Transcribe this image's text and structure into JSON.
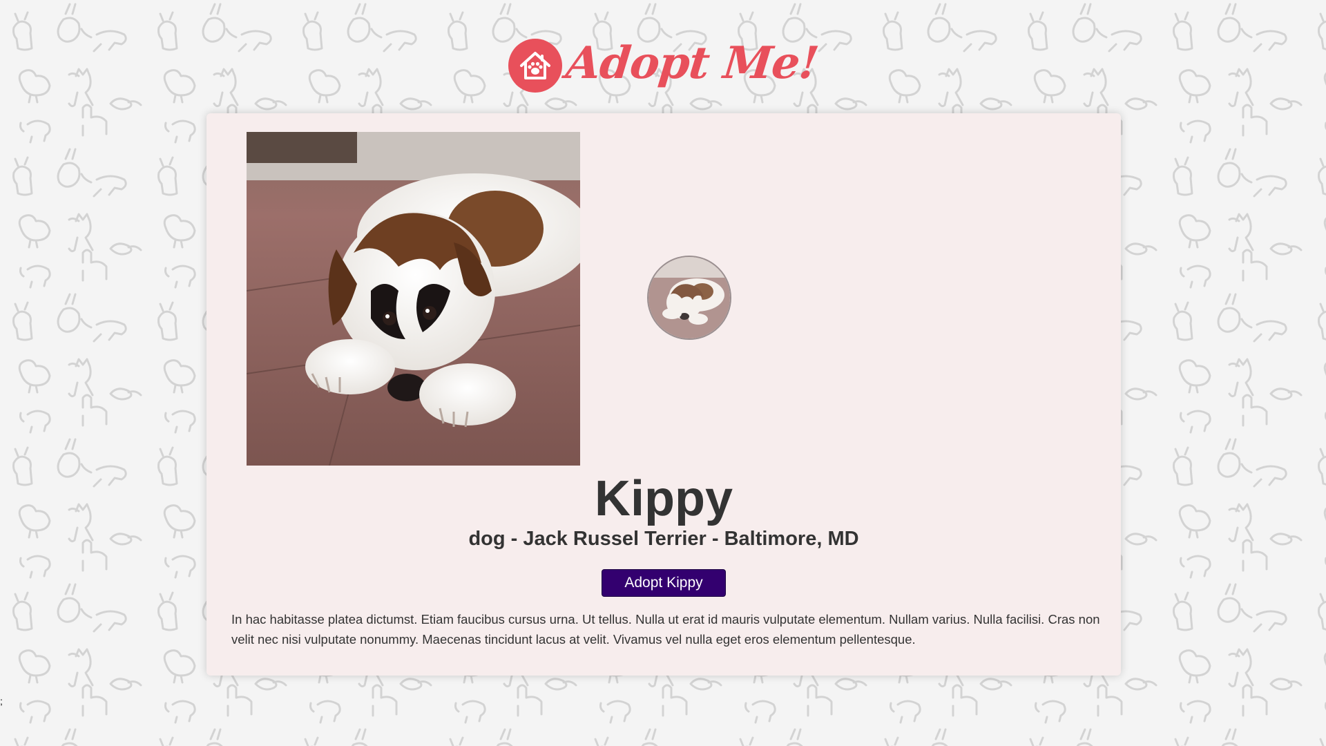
{
  "header": {
    "logo_text": "Adopt Me!"
  },
  "pet": {
    "name": "Kippy",
    "meta": "dog - Jack Russel Terrier - Baltimore, MD",
    "adopt_label": "Adopt Kippy",
    "description": "In hac habitasse platea dictumst. Etiam faucibus cursus urna. Ut tellus. Nulla ut erat id mauris vulputate elementum. Nullam varius. Nulla facilisi. Cras non velit nec nisi vulputate nonummy. Maecenas tincidunt lacus at velit. Vivamus vel nulla eget eros elementum pellentesque."
  },
  "page": {
    "stray_text": ";"
  },
  "colors": {
    "brand": "#e8505b",
    "button": "#33006f",
    "card": "#f7eded",
    "text": "#333333"
  },
  "icons": {
    "logo": "house-paw-icon",
    "background": "animal-doodle-pattern"
  }
}
